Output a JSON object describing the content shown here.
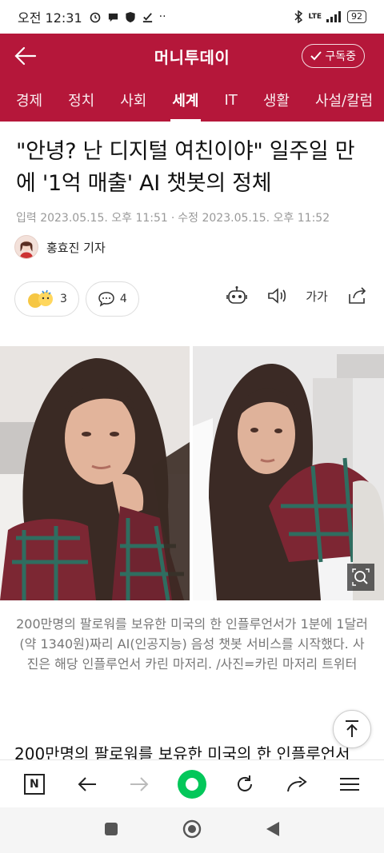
{
  "status_bar": {
    "time": "오전 12:31",
    "battery": "92",
    "network": "LTE"
  },
  "header": {
    "title": "머니투데이",
    "subscribe_label": "구독중"
  },
  "categories": [
    "경제",
    "정치",
    "사회",
    "세계",
    "IT",
    "생활",
    "사설/칼럼"
  ],
  "active_category": "세계",
  "article": {
    "headline": "\"안녕? 난 디지털 여친이야\" 일주일 만에 '1억 매출' AI 챗봇의 정체",
    "published": "입력 2023.05.15. 오후 11:51",
    "updated": "수정 2023.05.15. 오후 11:52",
    "author": "홍효진 기자",
    "reaction_count": "3",
    "comment_count": "4",
    "font_size_label": "가가",
    "caption": "200만명의 팔로워를 보유한 미국의 한 인플루언서가 1분에 1달러(약 1340원)짜리 AI(인공지능) 음성 챗봇 서비스를 시작했다. 사진은 해당 인플루언서 카린 마저리. /사진=카린 마저리 트위터",
    "body_start": "200만명의 팔로워를 보유한 미국의 한 인플루언서"
  },
  "colors": {
    "brand": "#b5173a",
    "green": "#03c75a"
  },
  "icons": {
    "back": "arrow-left-icon",
    "check": "check-icon",
    "robot": "robot-icon",
    "speaker": "speaker-icon",
    "share": "share-icon",
    "zoom": "zoom-icon",
    "scroll_top": "arrow-up-icon"
  }
}
